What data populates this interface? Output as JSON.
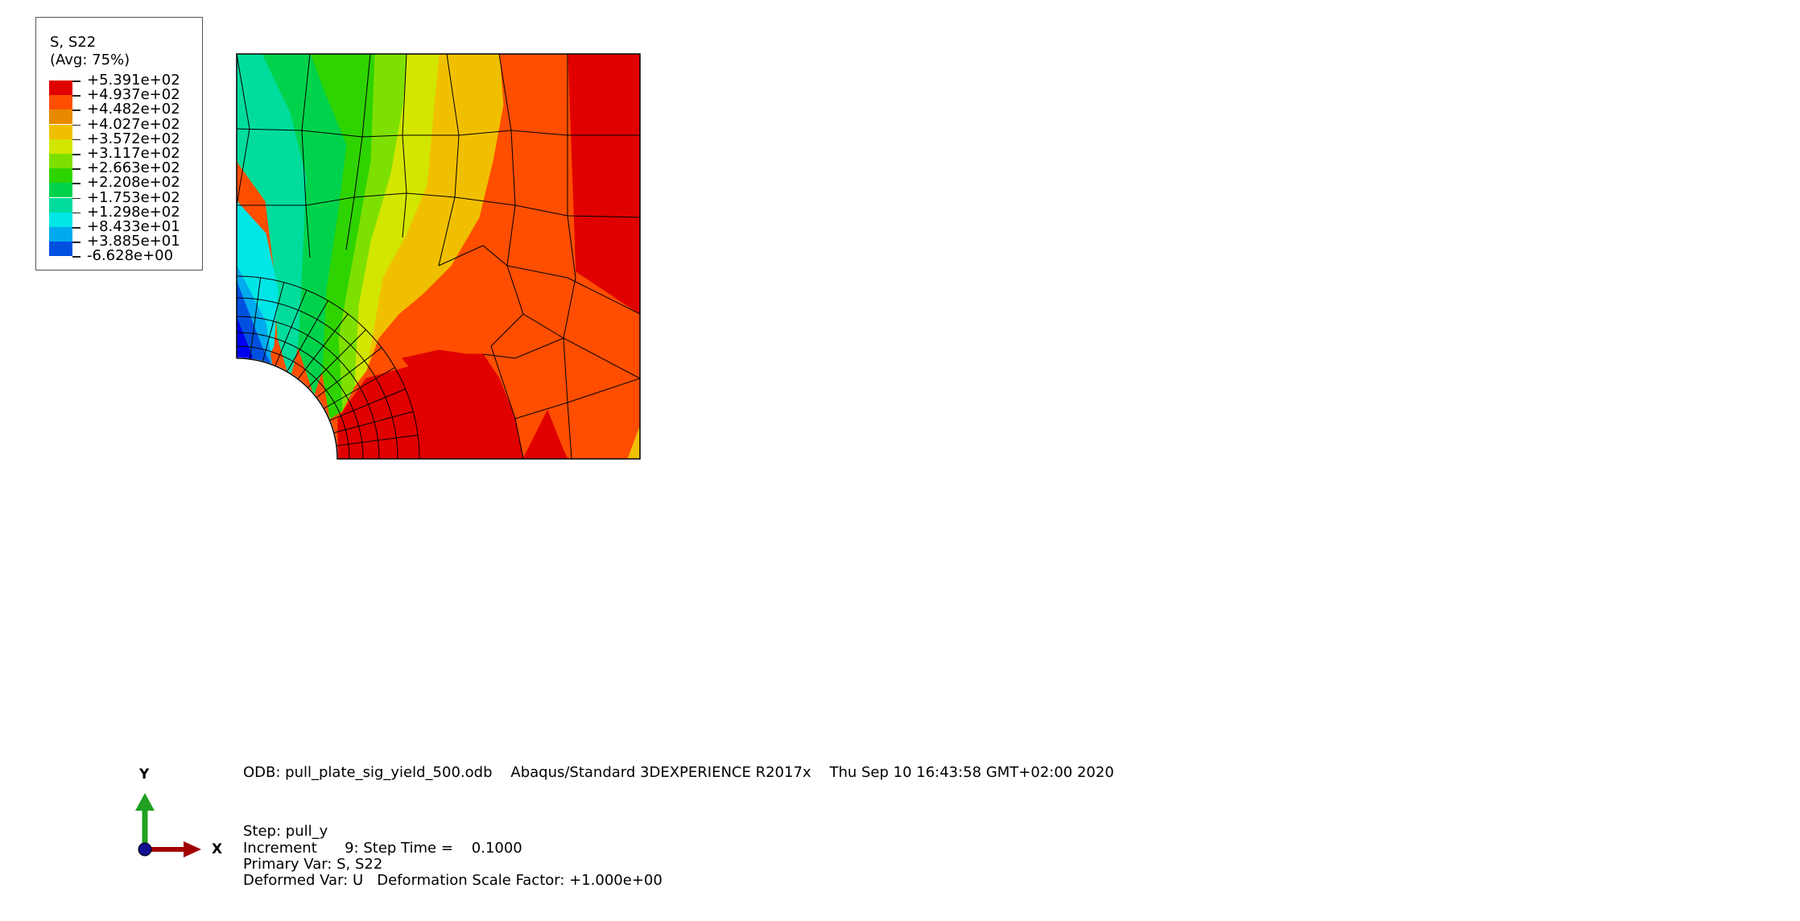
{
  "legend": {
    "title": "S, S22",
    "subtitle": "(Avg: 75%)",
    "levels": [
      {
        "label": "+5.391e+02",
        "color": "#e00000"
      },
      {
        "label": "+4.937e+02",
        "color": "#ff4e00"
      },
      {
        "label": "+4.482e+02",
        "color": "#e88a00"
      },
      {
        "label": "+4.027e+02",
        "color": "#f0c000"
      },
      {
        "label": "+3.572e+02",
        "color": "#d2e600"
      },
      {
        "label": "+3.117e+02",
        "color": "#7ee000"
      },
      {
        "label": "+2.663e+02",
        "color": "#2ed400"
      },
      {
        "label": "+2.208e+02",
        "color": "#00d24c"
      },
      {
        "label": "+1.753e+02",
        "color": "#00dc9c"
      },
      {
        "label": "+1.298e+02",
        "color": "#00e6e6"
      },
      {
        "label": "+8.433e+01",
        "color": "#00aaee"
      },
      {
        "label": "+3.885e+01",
        "color": "#0050e0"
      },
      {
        "label": "-6.628e+00",
        "color": "#0000f0"
      }
    ]
  },
  "info": {
    "odb_line": "ODB: pull_plate_sig_yield_500.odb    Abaqus/Standard 3DEXPERIENCE R2017x    Thu Sep 10 16:43:58 GMT+02:00 2020",
    "step_line": "Step: pull_y",
    "increment_line": "Increment      9: Step Time =    0.1000",
    "primary_var_line": "Primary Var: S, S22",
    "deformed_var_line": "Deformed Var: U   Deformation Scale Factor: +1.000e+00"
  },
  "triad": {
    "x_label": "X",
    "y_label": "Y",
    "x_color": "#a00000",
    "y_color": "#20a020",
    "origin_color": "#101090"
  },
  "mesh": {
    "line_color": "#000000"
  }
}
